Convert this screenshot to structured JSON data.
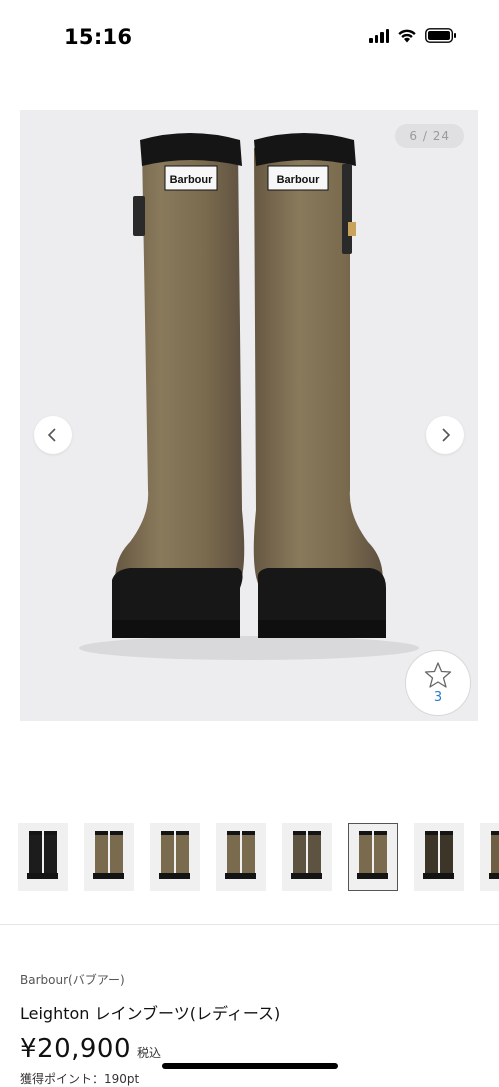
{
  "status_bar": {
    "time": "15:16"
  },
  "gallery": {
    "counter": "6 / 24",
    "boot_label": "Barbour",
    "favorite_count": "3",
    "colors": {
      "boot": "#7a6a4e",
      "sole": "#141414",
      "background": "#ededef"
    }
  },
  "thumbnails": [
    {
      "color": "#1c1c1c",
      "active": false
    },
    {
      "color": "#7a6a4e",
      "active": false
    },
    {
      "color": "#7a6a4e",
      "active": false
    },
    {
      "color": "#7a6a4e",
      "active": false
    },
    {
      "color": "#5e5240",
      "active": false
    },
    {
      "color": "#7a6a4e",
      "active": true
    },
    {
      "color": "#3e3529",
      "active": false
    },
    {
      "color": "#6e5e44",
      "active": false
    }
  ],
  "product": {
    "brand": "Barbour(バブアー)",
    "name": "Leighton レインブーツ(レディース)",
    "price": "¥20,900",
    "tax_label": "税込",
    "points": "獲得ポイント：190pt"
  }
}
